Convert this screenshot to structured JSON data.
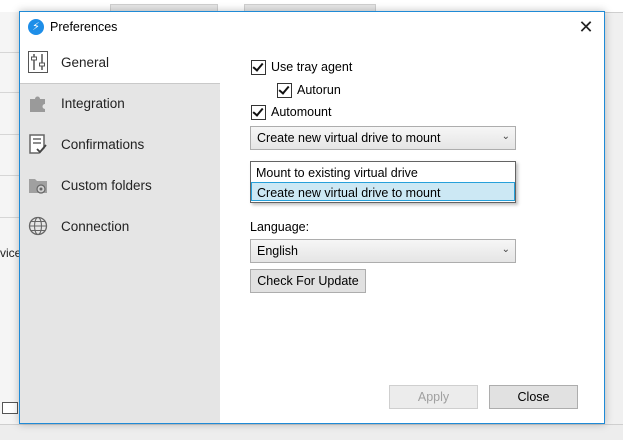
{
  "background": {
    "partial_text": "vice"
  },
  "dialog": {
    "title": "Preferences",
    "app_icon": "bolt-icon",
    "close_label": "✕"
  },
  "sidebar": {
    "items": [
      {
        "label": "General",
        "icon": "sliders-icon",
        "selected": true
      },
      {
        "label": "Integration",
        "icon": "puzzle-icon",
        "selected": false
      },
      {
        "label": "Confirmations",
        "icon": "checklist-icon",
        "selected": false
      },
      {
        "label": "Custom folders",
        "icon": "folder-gear-icon",
        "selected": false
      },
      {
        "label": "Connection",
        "icon": "globe-icon",
        "selected": false
      }
    ]
  },
  "general": {
    "use_tray_agent": {
      "label": "Use tray agent",
      "checked": true
    },
    "autorun": {
      "label": "Autorun",
      "checked": true
    },
    "automount": {
      "label": "Automount",
      "checked": true
    },
    "mount_select": {
      "value": "Create new virtual drive to mount",
      "options": [
        "Mount to existing virtual drive",
        "Create new virtual drive to mount"
      ],
      "highlighted_index": 1
    },
    "language_label": "Language:",
    "language_select": {
      "value": "English"
    },
    "check_update_label": "Check For Update"
  },
  "footer": {
    "apply_label": "Apply",
    "apply_enabled": false,
    "close_label": "Close"
  },
  "colors": {
    "accent": "#1f8ad6",
    "sidebar_bg": "#e5e5e5",
    "highlight_bg": "#cce8f4",
    "highlight_border": "#26a0da"
  }
}
